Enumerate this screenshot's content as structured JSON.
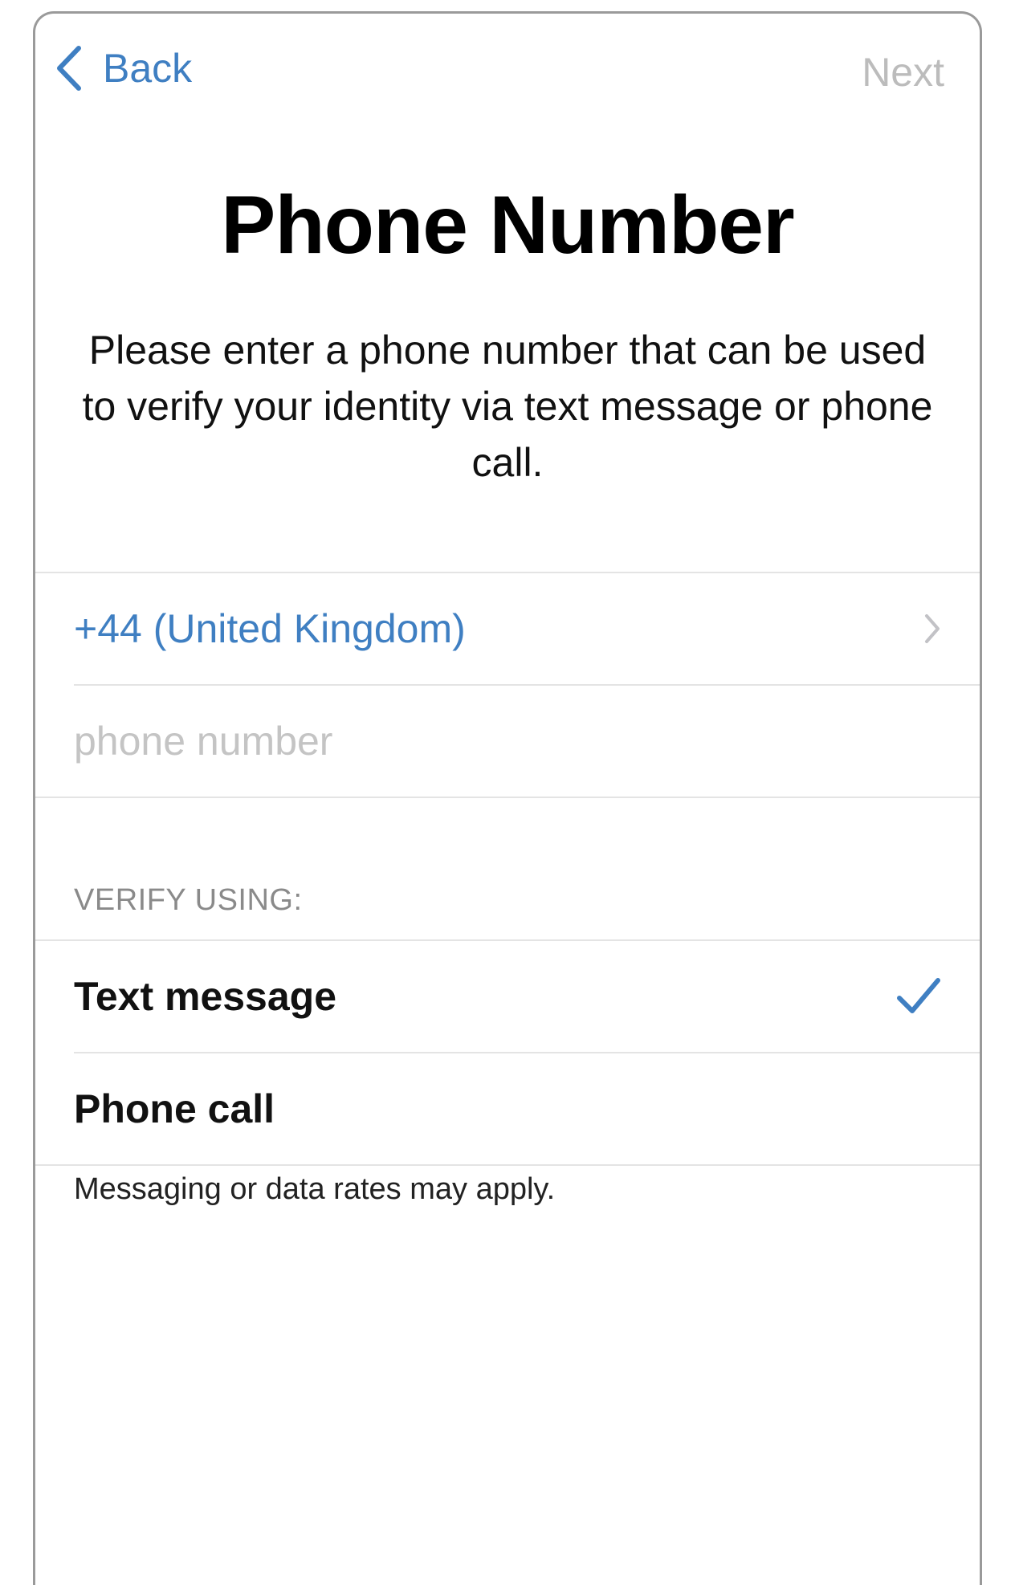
{
  "nav": {
    "back_label": "Back",
    "next_label": "Next"
  },
  "header": {
    "title": "Phone Number",
    "description": "Please enter a phone number that can be used to verify your identity via text message or phone call."
  },
  "phone_form": {
    "country_label": "+44 (United Kingdom)",
    "phone_value": "",
    "phone_placeholder": "phone number"
  },
  "verify": {
    "section_label": "VERIFY USING:",
    "options": [
      {
        "label": "Text message",
        "selected": true
      },
      {
        "label": "Phone call",
        "selected": false
      }
    ],
    "footnote": "Messaging or data rates may apply."
  },
  "colors": {
    "accent": "#3f7fc2",
    "disabled": "#bcbcbc",
    "placeholder": "#c4c4c4",
    "section_header": "#8a8a8a",
    "separator": "#e4e4e4"
  }
}
